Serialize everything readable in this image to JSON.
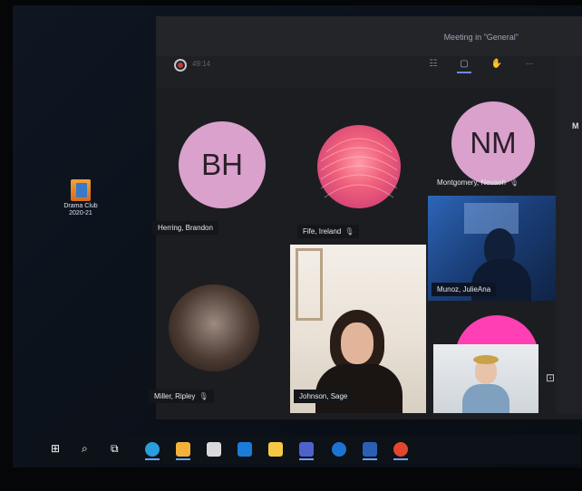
{
  "desktop": {
    "icon_label_line1": "Drama Club",
    "icon_label_line2": "2020-21"
  },
  "meeting": {
    "title": "Meeting in \"General\"",
    "timer": "49:14",
    "more_label": "..."
  },
  "participants": [
    {
      "name": "Herring, Brandon",
      "initials": "BH",
      "muted": false
    },
    {
      "name": "Fife, Ireland",
      "initials": "",
      "muted": true
    },
    {
      "name": "Montgomery, Nevaeh",
      "initials": "NM",
      "muted": true
    },
    {
      "name": "Munoz, JulieAna",
      "initials": "",
      "muted": false
    },
    {
      "name": "Miller, Ripley",
      "initials": "",
      "muted": true
    },
    {
      "name": "Johnson, Sage",
      "initials": "",
      "muted": false
    }
  ],
  "side_panel": {
    "letter": "M"
  },
  "colors": {
    "accent": "#6b8af7",
    "avatar_pink": "#d9a1cc",
    "teams_bg": "#1c1d21"
  },
  "icons": {
    "mic_off": "mic-off-icon",
    "taskbar": [
      "windows-start-icon",
      "search-icon",
      "task-view-icon",
      "edge-icon",
      "file-explorer-icon",
      "store-icon",
      "outlook-icon",
      "sticky-notes-icon",
      "teams-icon",
      "onedrive-icon",
      "word-icon",
      "powerpoint-icon"
    ]
  }
}
